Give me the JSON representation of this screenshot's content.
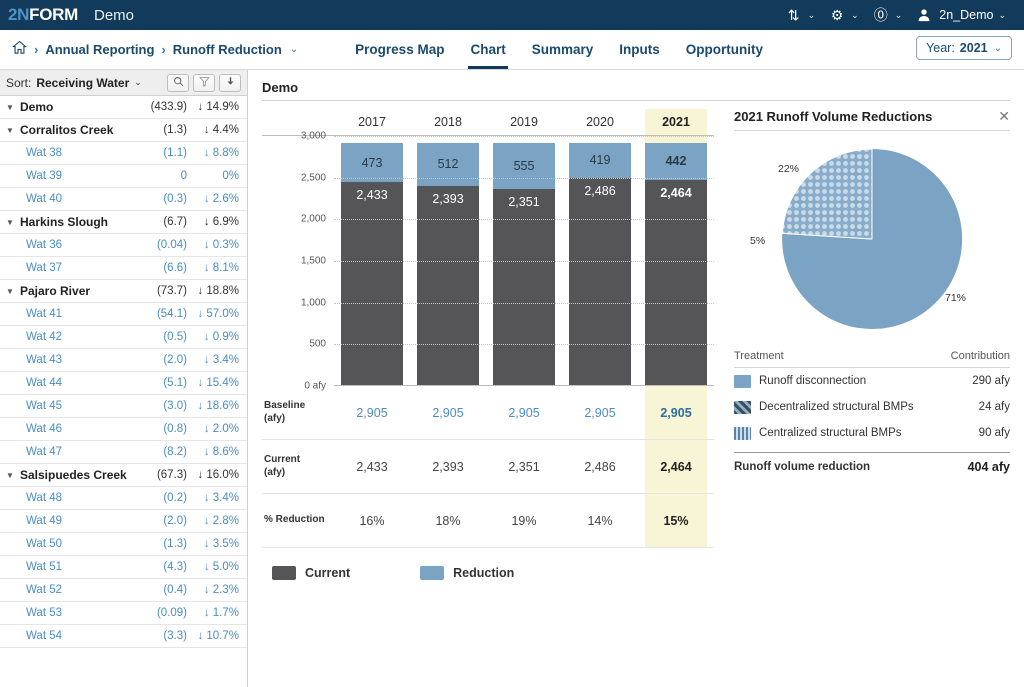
{
  "topbar": {
    "logo_two": "2N",
    "logo_form": "FORM",
    "app_label": "Demo",
    "sort_icon": "sort-arrows-icon",
    "gear_icon": "gear-icon",
    "help_icon": "help-circle-icon",
    "user_icon": "user-avatar-icon",
    "user_name": "2n_Demo",
    "caret": "⌄"
  },
  "nav": {
    "home_icon": "home-icon",
    "separator": "›",
    "crumbs": [
      {
        "label": "Annual Reporting",
        "caret": ""
      },
      {
        "label": "Runoff Reduction",
        "caret": "⌄"
      }
    ],
    "tabs": [
      {
        "label": "Progress Map",
        "active": false
      },
      {
        "label": "Chart",
        "active": true
      },
      {
        "label": "Summary",
        "active": false
      },
      {
        "label": "Inputs",
        "active": false
      },
      {
        "label": "Opportunity",
        "active": false
      }
    ],
    "year_label": "Year:",
    "year_value": "2021",
    "year_caret": "⌄"
  },
  "sidebar": {
    "sort_label": "Sort:",
    "sort_value": "Receiving Water",
    "sort_caret": "⌄",
    "buttons": [
      {
        "name": "search-icon",
        "glyph": "⚲"
      },
      {
        "name": "filter-icon",
        "glyph": "▼"
      },
      {
        "name": "download-icon",
        "glyph": "↓"
      }
    ],
    "rows": [
      {
        "type": "group",
        "label": "Demo",
        "value": "(433.9)",
        "pct": "↓ 14.9%"
      },
      {
        "type": "group",
        "label": "Corralitos Creek",
        "value": "(1.3)",
        "pct": "↓ 4.4%"
      },
      {
        "type": "leaf",
        "label": "Wat 38",
        "value": "(1.1)",
        "pct": "↓ 8.8%"
      },
      {
        "type": "leaf",
        "label": "Wat 39",
        "value": "0",
        "pct": "0%"
      },
      {
        "type": "leaf",
        "label": "Wat 40",
        "value": "(0.3)",
        "pct": "↓ 2.6%"
      },
      {
        "type": "group",
        "label": "Harkins Slough",
        "value": "(6.7)",
        "pct": "↓ 6.9%"
      },
      {
        "type": "leaf",
        "label": "Wat 36",
        "value": "(0.04)",
        "pct": "↓ 0.3%"
      },
      {
        "type": "leaf",
        "label": "Wat 37",
        "value": "(6.6)",
        "pct": "↓ 8.1%"
      },
      {
        "type": "group",
        "label": "Pajaro River",
        "value": "(73.7)",
        "pct": "↓ 18.8%"
      },
      {
        "type": "leaf",
        "label": "Wat 41",
        "value": "(54.1)",
        "pct": "↓ 57.0%"
      },
      {
        "type": "leaf",
        "label": "Wat 42",
        "value": "(0.5)",
        "pct": "↓ 0.9%"
      },
      {
        "type": "leaf",
        "label": "Wat 43",
        "value": "(2.0)",
        "pct": "↓ 3.4%"
      },
      {
        "type": "leaf",
        "label": "Wat 44",
        "value": "(5.1)",
        "pct": "↓ 15.4%"
      },
      {
        "type": "leaf",
        "label": "Wat 45",
        "value": "(3.0)",
        "pct": "↓ 18.6%"
      },
      {
        "type": "leaf",
        "label": "Wat 46",
        "value": "(0.8)",
        "pct": "↓ 2.0%"
      },
      {
        "type": "leaf",
        "label": "Wat 47",
        "value": "(8.2)",
        "pct": "↓ 8.6%"
      },
      {
        "type": "group",
        "label": "Salsipuedes Creek",
        "value": "(67.3)",
        "pct": "↓ 16.0%"
      },
      {
        "type": "leaf",
        "label": "Wat 48",
        "value": "(0.2)",
        "pct": "↓ 3.4%"
      },
      {
        "type": "leaf",
        "label": "Wat 49",
        "value": "(2.0)",
        "pct": "↓ 2.8%"
      },
      {
        "type": "leaf",
        "label": "Wat 50",
        "value": "(1.3)",
        "pct": "↓ 3.5%"
      },
      {
        "type": "leaf",
        "label": "Wat 51",
        "value": "(4.3)",
        "pct": "↓ 5.0%"
      },
      {
        "type": "leaf",
        "label": "Wat 52",
        "value": "(0.4)",
        "pct": "↓ 2.3%"
      },
      {
        "type": "leaf",
        "label": "Wat 53",
        "value": "(0.09)",
        "pct": "↓ 1.7%"
      },
      {
        "type": "leaf",
        "label": "Wat 54",
        "value": "(3.3)",
        "pct": "↓ 10.7%"
      }
    ]
  },
  "main": {
    "title": "Demo"
  },
  "right_panel": {
    "title": "2021 Runoff Volume Reductions",
    "close_icon": "close-icon",
    "table_head": {
      "treatment": "Treatment",
      "contribution": "Contribution"
    },
    "total_label": "Runoff volume reduction",
    "total_value": "404 afy"
  },
  "colors": {
    "navy": "#113A5B",
    "blue_reduction": "#7BA3C4",
    "gray_current": "#555557",
    "highlight": "#F7F5D5",
    "link_blue": "#4a8dc5"
  },
  "chart_data": [
    {
      "type": "bar",
      "title": "Demo",
      "stacked": true,
      "categories": [
        "2017",
        "2018",
        "2019",
        "2020",
        "2021"
      ],
      "selected_category": "2021",
      "series": [
        {
          "name": "Current",
          "values": [
            2433,
            2393,
            2351,
            2486,
            2464
          ],
          "labels": [
            "2,433",
            "2,393",
            "2,351",
            "2,486",
            "2,464"
          ],
          "color": "#555557"
        },
        {
          "name": "Reduction",
          "values": [
            473,
            512,
            555,
            419,
            442
          ],
          "labels": [
            "473",
            "512",
            "555",
            "419",
            "442"
          ],
          "color": "#7BA3C4"
        }
      ],
      "ylabel": "",
      "xlabel": "",
      "ylim": [
        0,
        3000
      ],
      "yticks": [
        3000,
        2500,
        2000,
        1500,
        1000,
        500,
        0
      ],
      "ytick_labels": [
        "3,000",
        "2,500",
        "2,000",
        "1,500",
        "1,000",
        "500",
        "0 afy"
      ],
      "grid": true,
      "legend": [
        "Current",
        "Reduction"
      ],
      "legend_position": "bottom",
      "table": {
        "rows": [
          {
            "label": "Baseline\n(afy)",
            "label_line1": "Baseline",
            "label_line2": "(afy)",
            "values": [
              "2,905",
              "2,905",
              "2,905",
              "2,905",
              "2,905"
            ]
          },
          {
            "label": "Current\n(afy)",
            "label_line1": "Current",
            "label_line2": "(afy)",
            "values": [
              "2,433",
              "2,393",
              "2,351",
              "2,486",
              "2,464"
            ]
          },
          {
            "label": "% Reduction",
            "label_line1": "% Reduction",
            "label_line2": "",
            "values": [
              "16%",
              "18%",
              "19%",
              "14%",
              "15%"
            ]
          }
        ]
      }
    },
    {
      "type": "pie",
      "title": "2021 Runoff Volume Reductions",
      "labels": [
        "Runoff disconnection",
        "Decentralized structural BMPs",
        "Centralized structural BMPs"
      ],
      "percent_labels": [
        "71%",
        "5%",
        "22%"
      ],
      "values": [
        290,
        24,
        90
      ],
      "value_labels": [
        "290 afy",
        "24 afy",
        "90 afy"
      ],
      "unit": "afy",
      "total": 404,
      "total_label": "404 afy",
      "patterns": [
        "solid",
        "diagonal-stripe",
        "checker"
      ],
      "color": "#7BA3C4",
      "legend_position": "bottom"
    }
  ]
}
